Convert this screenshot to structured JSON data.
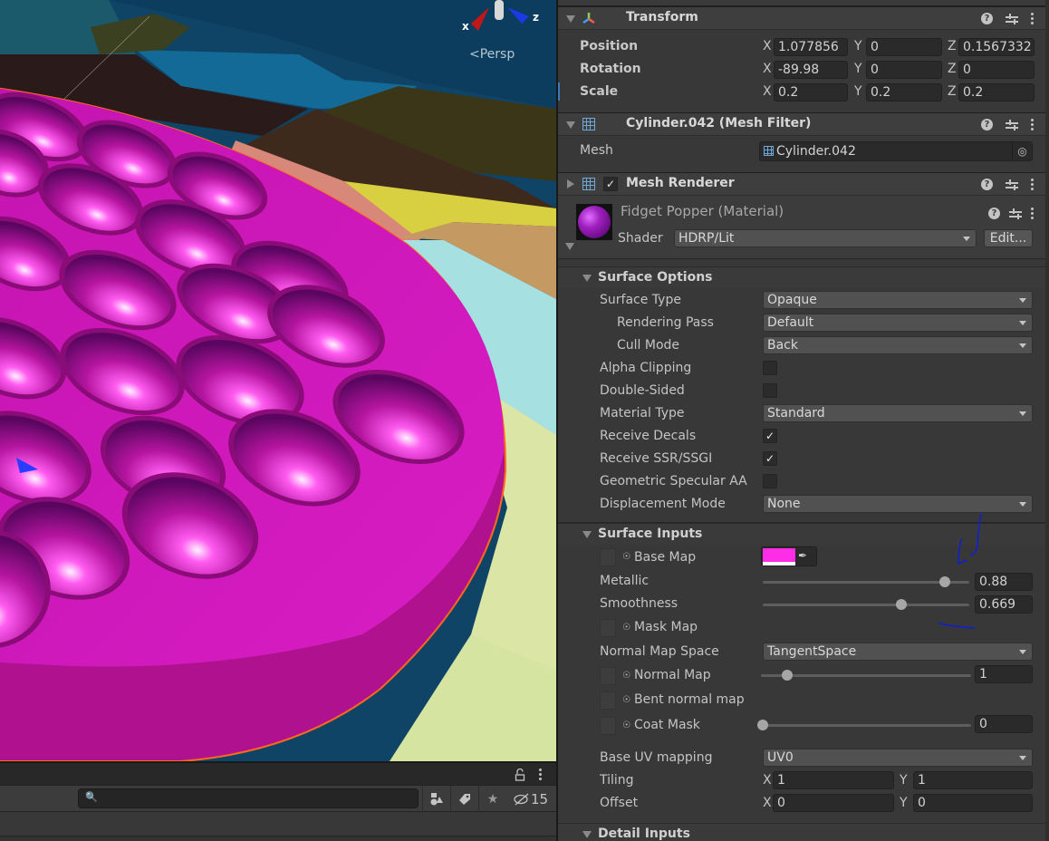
{
  "scene": {
    "gizmo": {
      "x_label": "x",
      "z_label": "z",
      "projection_label": "Persp"
    },
    "material_color": "#d61fc0",
    "selection_outline_color": "#ff6a1a"
  },
  "hierarchy_bar": {
    "search_placeholder": "",
    "hidden_count": "15",
    "buttons": [
      "scene-visibility",
      "label-filter",
      "favorites",
      "hidden-objects"
    ]
  },
  "inspector": {
    "transform": {
      "title": "Transform",
      "rows": [
        {
          "label": "Position",
          "x": "1.077856",
          "y": "0",
          "z": "0.1567332"
        },
        {
          "label": "Rotation",
          "x": "-89.98",
          "y": "0",
          "z": "0"
        },
        {
          "label": "Scale",
          "x": "0.2",
          "y": "0.2",
          "z": "0.2"
        }
      ],
      "axis_x": "X",
      "axis_y": "Y",
      "axis_z": "Z"
    },
    "mesh_filter": {
      "title": "Cylinder.042 (Mesh Filter)",
      "mesh_label": "Mesh",
      "mesh_value": "Cylinder.042"
    },
    "mesh_renderer": {
      "title": "Mesh Renderer",
      "enabled": true
    },
    "material": {
      "name": "Fidget Popper (Material)",
      "shader_label": "Shader",
      "shader_value": "HDRP/Lit",
      "edit_label": "Edit..."
    },
    "surface_options": {
      "title": "Surface Options",
      "surface_type": {
        "label": "Surface Type",
        "value": "Opaque"
      },
      "rendering_pass": {
        "label": "Rendering Pass",
        "value": "Default"
      },
      "cull_mode": {
        "label": "Cull Mode",
        "value": "Back"
      },
      "alpha_clipping": {
        "label": "Alpha Clipping",
        "checked": false
      },
      "double_sided": {
        "label": "Double-Sided",
        "checked": false
      },
      "material_type": {
        "label": "Material Type",
        "value": "Standard"
      },
      "receive_decals": {
        "label": "Receive Decals",
        "checked": true
      },
      "receive_ssr": {
        "label": "Receive SSR/SSGI",
        "checked": true
      },
      "geometric_specular_aa": {
        "label": "Geometric Specular AA",
        "checked": false
      },
      "displacement_mode": {
        "label": "Displacement Mode",
        "value": "None"
      }
    },
    "surface_inputs": {
      "title": "Surface Inputs",
      "base_map": {
        "label": "Base Map",
        "color": "#ff2ee6"
      },
      "metallic": {
        "label": "Metallic",
        "value": "0.88",
        "fraction": 0.88
      },
      "smoothness": {
        "label": "Smoothness",
        "value": "0.669",
        "fraction": 0.669
      },
      "mask_map": {
        "label": "Mask Map"
      },
      "normal_map_space": {
        "label": "Normal Map Space",
        "value": "TangentSpace"
      },
      "normal_map": {
        "label": "Normal Map",
        "value": "1",
        "fraction": 0.125
      },
      "bent_normal_map": {
        "label": "Bent normal map"
      },
      "coat_mask": {
        "label": "Coat Mask",
        "value": "0",
        "fraction": 0
      },
      "base_uv_mapping": {
        "label": "Base UV mapping",
        "value": "UV0"
      },
      "tiling": {
        "label": "Tiling",
        "x": "1",
        "y": "1"
      },
      "offset": {
        "label": "Offset",
        "x": "0",
        "y": "0"
      }
    },
    "detail_inputs": {
      "title": "Detail Inputs"
    },
    "check_glyph": "✓"
  }
}
